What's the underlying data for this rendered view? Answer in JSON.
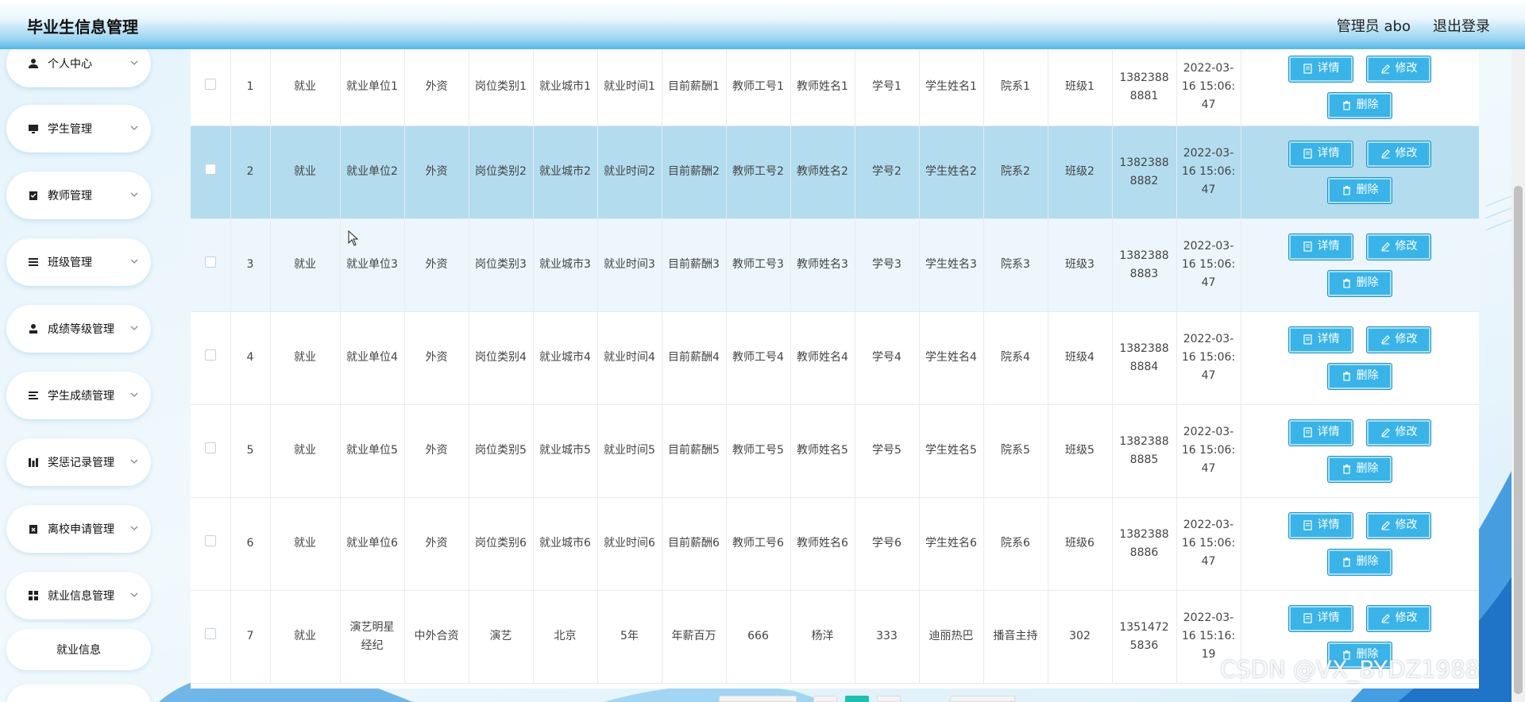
{
  "header": {
    "app_title": "毕业生信息管理",
    "user_label": "管理员 abo",
    "logout_label": "退出登录"
  },
  "sidebar": {
    "items": [
      {
        "label": "个人中心",
        "icon": "user-icon"
      },
      {
        "label": "学生管理",
        "icon": "monitor-icon"
      },
      {
        "label": "教师管理",
        "icon": "clipboard-check-icon"
      },
      {
        "label": "班级管理",
        "icon": "list-icon"
      },
      {
        "label": "成绩等级管理",
        "icon": "person-icon"
      },
      {
        "label": "学生成绩管理",
        "icon": "lines-icon"
      },
      {
        "label": "奖惩记录管理",
        "icon": "bars-icon"
      },
      {
        "label": "离校申请管理",
        "icon": "clipboard-x-icon"
      },
      {
        "label": "就业信息管理",
        "icon": "grid-icon"
      }
    ],
    "sub_items": [
      {
        "label": "就业信息"
      }
    ]
  },
  "table": {
    "rows": [
      {
        "cells": [
          "1",
          "就业",
          "就业单位1",
          "外资",
          "岗位类别1",
          "就业城市1",
          "就业时间1",
          "目前薪酬1",
          "教师工号1",
          "教师姓名1",
          "学号1",
          "学生姓名1",
          "院系1",
          "班级1",
          "13823888881",
          "2022-03-16 15:06:47"
        ],
        "style": "normal"
      },
      {
        "cells": [
          "2",
          "就业",
          "就业单位2",
          "外资",
          "岗位类别2",
          "就业城市2",
          "就业时间2",
          "目前薪酬2",
          "教师工号2",
          "教师姓名2",
          "学号2",
          "学生姓名2",
          "院系2",
          "班级2",
          "13823888882",
          "2022-03-16 15:06:47"
        ],
        "style": "highlight"
      },
      {
        "cells": [
          "3",
          "就业",
          "就业单位3",
          "外资",
          "岗位类别3",
          "就业城市3",
          "就业时间3",
          "目前薪酬3",
          "教师工号3",
          "教师姓名3",
          "学号3",
          "学生姓名3",
          "院系3",
          "班级3",
          "13823888883",
          "2022-03-16 15:06:47"
        ],
        "style": "light"
      },
      {
        "cells": [
          "4",
          "就业",
          "就业单位4",
          "外资",
          "岗位类别4",
          "就业城市4",
          "就业时间4",
          "目前薪酬4",
          "教师工号4",
          "教师姓名4",
          "学号4",
          "学生姓名4",
          "院系4",
          "班级4",
          "13823888884",
          "2022-03-16 15:06:47"
        ],
        "style": "normal"
      },
      {
        "cells": [
          "5",
          "就业",
          "就业单位5",
          "外资",
          "岗位类别5",
          "就业城市5",
          "就业时间5",
          "目前薪酬5",
          "教师工号5",
          "教师姓名5",
          "学号5",
          "学生姓名5",
          "院系5",
          "班级5",
          "13823888885",
          "2022-03-16 15:06:47"
        ],
        "style": "normal"
      },
      {
        "cells": [
          "6",
          "就业",
          "就业单位6",
          "外资",
          "岗位类别6",
          "就业城市6",
          "就业时间6",
          "目前薪酬6",
          "教师工号6",
          "教师姓名6",
          "学号6",
          "学生姓名6",
          "院系6",
          "班级6",
          "13823888886",
          "2022-03-16 15:06:47"
        ],
        "style": "normal"
      },
      {
        "cells": [
          "7",
          "就业",
          "演艺明星经纪",
          "中外合资",
          "演艺",
          "北京",
          "5年",
          "年薪百万",
          "666",
          "杨洋",
          "333",
          "迪丽热巴",
          "播音主持",
          "302",
          "13514725836",
          "2022-03-16 15:16:19"
        ],
        "style": "normal"
      }
    ],
    "actions": {
      "detail_label": "详情",
      "edit_label": "修改",
      "delete_label": "删除"
    }
  },
  "colors": {
    "accent": "#3ab4e8",
    "row_highlight": "#b3dcef",
    "row_light": "#ecf6fc",
    "pager_active": "#20c0b0"
  },
  "watermark": "CSDN @VX_BYDZ1988"
}
